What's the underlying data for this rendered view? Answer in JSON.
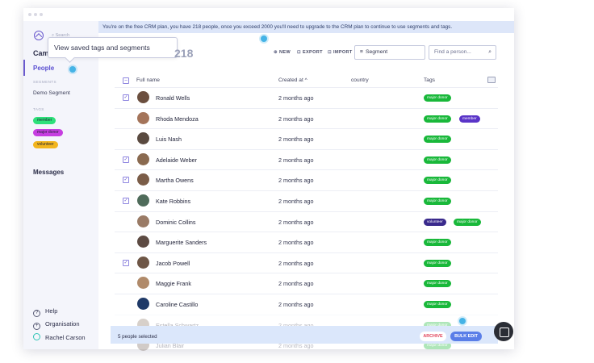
{
  "banner": "You're on the free CRM plan, you have 218 people, once you exceed 2000 you'll need to upgrade to the CRM plan to continue to use segments and tags.",
  "app": {
    "search_placeholder": "Search",
    "name_partial": "Cam",
    "count_partial": "218"
  },
  "tooltip": "View saved tags and segments",
  "sidebar": {
    "people": "People",
    "segments_heading": "SEGMENTS",
    "segment": "Demo Segment",
    "tags_heading": "TAGS",
    "tags": [
      {
        "label": "member",
        "color": "#2ee07a"
      },
      {
        "label": "major donor",
        "color": "#c63ee0"
      },
      {
        "label": "volunteer",
        "color": "#f2b51e"
      }
    ],
    "messages": "Messages",
    "help": "Help",
    "organisation": "Organisation",
    "user": "Rachel Carson"
  },
  "toolbar": {
    "new": "NEW",
    "export": "EXPORT",
    "import": "IMPORT",
    "segment": "Segment",
    "find_placeholder": "Find a person..."
  },
  "columns": {
    "name": "Full name",
    "created": "Created at",
    "sort_indicator": "^",
    "country": "country",
    "tags": "Tags"
  },
  "rows": [
    {
      "name": "Ronald Wells",
      "date": "2 months ago",
      "checked": true,
      "tags": [
        "major donor"
      ]
    },
    {
      "name": "Rhoda Mendoza",
      "date": "2 months ago",
      "checked": false,
      "tags": [
        "major donor",
        "member"
      ]
    },
    {
      "name": "Luis Nash",
      "date": "2 months ago",
      "checked": false,
      "tags": [
        "major donor"
      ]
    },
    {
      "name": "Adelaide Weber",
      "date": "2 months ago",
      "checked": true,
      "tags": [
        "major donor"
      ]
    },
    {
      "name": "Martha Owens",
      "date": "2 months ago",
      "checked": true,
      "tags": [
        "major donor"
      ]
    },
    {
      "name": "Kate Robbins",
      "date": "2 months ago",
      "checked": true,
      "tags": [
        "major donor"
      ]
    },
    {
      "name": "Dominic Collins",
      "date": "2 months ago",
      "checked": false,
      "tags": [
        "volunteer",
        "major donor"
      ]
    },
    {
      "name": "Marguerite Sanders",
      "date": "2 months ago",
      "checked": false,
      "tags": [
        "major donor"
      ]
    },
    {
      "name": "Jacob Powell",
      "date": "2 months ago",
      "checked": true,
      "tags": [
        "major donor"
      ]
    },
    {
      "name": "Maggie Frank",
      "date": "2 months ago",
      "checked": false,
      "tags": [
        "major donor"
      ]
    },
    {
      "name": "Caroline Castillo",
      "date": "2 months ago",
      "checked": false,
      "tags": [
        "major donor"
      ]
    },
    {
      "name": "Estella Schwartz",
      "date": "2 months ago",
      "checked": false,
      "tags": [
        "major donor"
      ]
    },
    {
      "name": "Julian Blair",
      "date": "2 months ago",
      "checked": false,
      "tags": [
        "major donor"
      ]
    }
  ],
  "bottom": {
    "selected": "5 people selected",
    "archive": "ARCHIVE",
    "bulk_edit": "BULK EDIT"
  },
  "colors": {
    "accent": "#6a5acd",
    "major_donor": "#19b83a",
    "member": "#5a34c8",
    "volunteer": "#3a2a8c"
  }
}
